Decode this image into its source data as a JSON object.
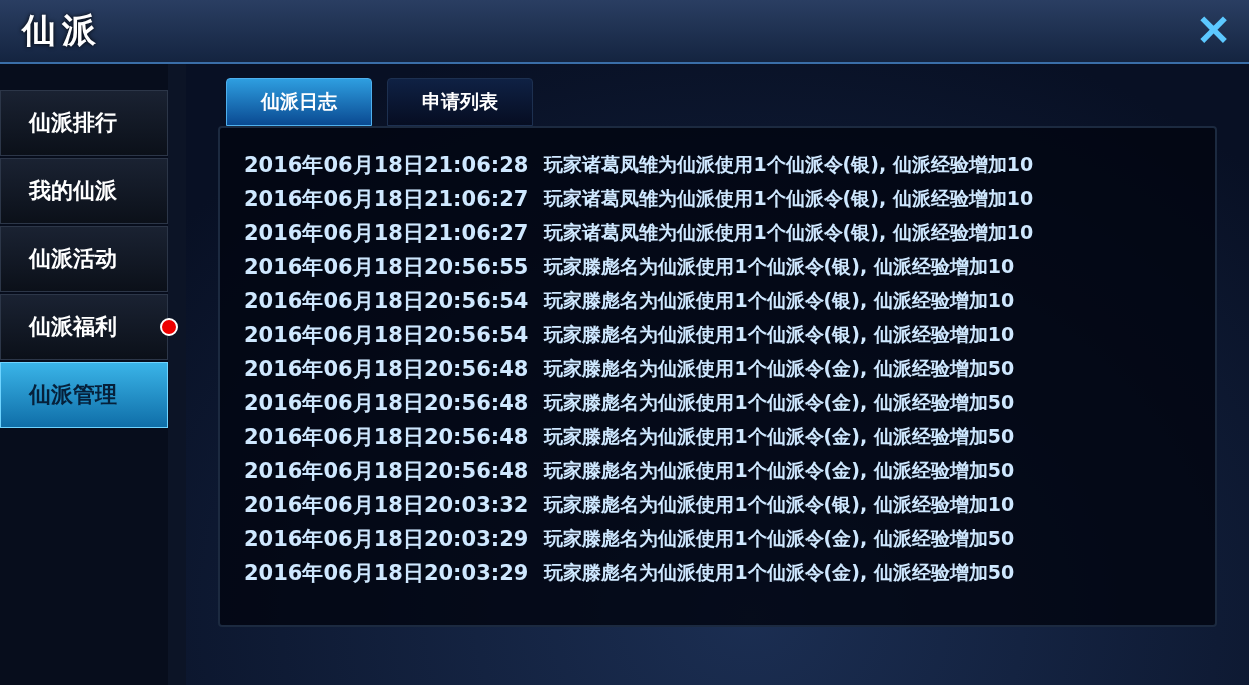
{
  "window": {
    "title": "仙派",
    "close": "✕"
  },
  "sidebar": {
    "items": [
      {
        "label": "仙派排行",
        "selected": false,
        "badge": false
      },
      {
        "label": "我的仙派",
        "selected": false,
        "badge": false
      },
      {
        "label": "仙派活动",
        "selected": false,
        "badge": false
      },
      {
        "label": "仙派福利",
        "selected": false,
        "badge": true
      },
      {
        "label": "仙派管理",
        "selected": true,
        "badge": false
      }
    ]
  },
  "tabs": [
    {
      "label": "仙派日志",
      "selected": true
    },
    {
      "label": "申请列表",
      "selected": false
    }
  ],
  "log": [
    {
      "time": "2016年06月18日21:06:28",
      "message": "玩家诸葛凤雏为仙派使用1个仙派令(银), 仙派经验增加10"
    },
    {
      "time": "2016年06月18日21:06:27",
      "message": "玩家诸葛凤雏为仙派使用1个仙派令(银), 仙派经验增加10"
    },
    {
      "time": "2016年06月18日21:06:27",
      "message": "玩家诸葛凤雏为仙派使用1个仙派令(银), 仙派经验增加10"
    },
    {
      "time": "2016年06月18日20:56:55",
      "message": "玩家滕彪名为仙派使用1个仙派令(银), 仙派经验增加10"
    },
    {
      "time": "2016年06月18日20:56:54",
      "message": "玩家滕彪名为仙派使用1个仙派令(银), 仙派经验增加10"
    },
    {
      "time": "2016年06月18日20:56:54",
      "message": "玩家滕彪名为仙派使用1个仙派令(银), 仙派经验增加10"
    },
    {
      "time": "2016年06月18日20:56:48",
      "message": "玩家滕彪名为仙派使用1个仙派令(金), 仙派经验增加50"
    },
    {
      "time": "2016年06月18日20:56:48",
      "message": "玩家滕彪名为仙派使用1个仙派令(金), 仙派经验增加50"
    },
    {
      "time": "2016年06月18日20:56:48",
      "message": "玩家滕彪名为仙派使用1个仙派令(金), 仙派经验增加50"
    },
    {
      "time": "2016年06月18日20:56:48",
      "message": "玩家滕彪名为仙派使用1个仙派令(金), 仙派经验增加50"
    },
    {
      "time": "2016年06月18日20:03:32",
      "message": "玩家滕彪名为仙派使用1个仙派令(银), 仙派经验增加10"
    },
    {
      "time": "2016年06月18日20:03:29",
      "message": "玩家滕彪名为仙派使用1个仙派令(金), 仙派经验增加50"
    },
    {
      "time": "2016年06月18日20:03:29",
      "message": "玩家滕彪名为仙派使用1个仙派令(金), 仙派经验增加50"
    }
  ]
}
